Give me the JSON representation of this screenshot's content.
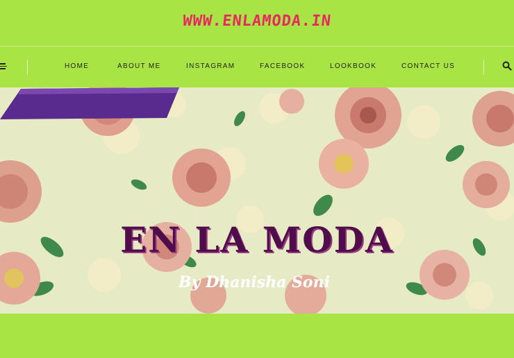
{
  "site": {
    "title": "WWW.ENLAMODA.IN"
  },
  "nav": {
    "items": [
      {
        "label": "HOME"
      },
      {
        "label": "ABOUT ME"
      },
      {
        "label": "INSTAGRAM"
      },
      {
        "label": "FACEBOOK"
      },
      {
        "label": "LOOKBOOK"
      },
      {
        "label": "CONTACT US"
      }
    ]
  },
  "banner": {
    "title": "EN LA MODA",
    "subtitle": "By Dhanisha Soni"
  },
  "colors": {
    "page_background": "#a8e544",
    "site_title": "#e8285f",
    "banner_title": "#4f0d49",
    "ribbon": "#5a2b8e"
  }
}
